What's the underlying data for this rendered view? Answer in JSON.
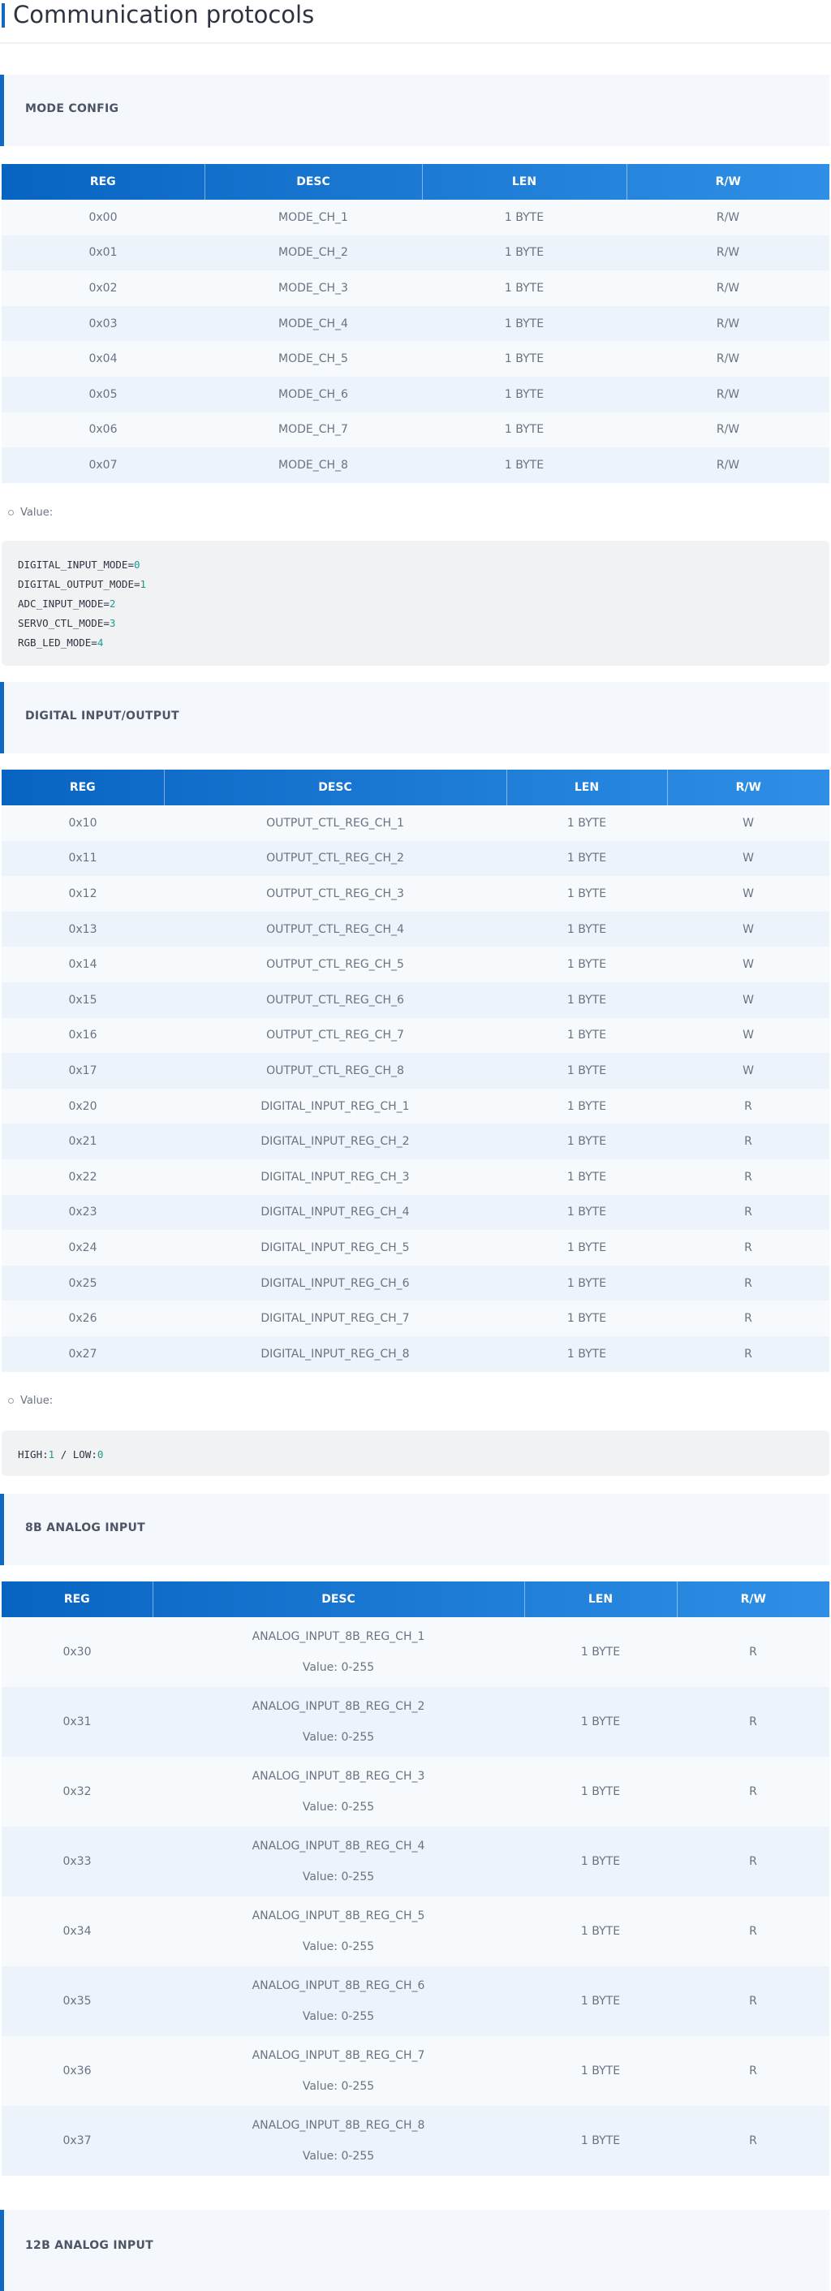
{
  "page": {
    "title": "Communication protocols"
  },
  "columns": [
    "REG",
    "DESC",
    "LEN",
    "R/W"
  ],
  "value_label": "Value:",
  "mode_config": {
    "heading": "MODE CONFIG",
    "rows": [
      [
        "0x00",
        "MODE_CH_1",
        "1 BYTE",
        "R/W"
      ],
      [
        "0x01",
        "MODE_CH_2",
        "1 BYTE",
        "R/W"
      ],
      [
        "0x02",
        "MODE_CH_3",
        "1 BYTE",
        "R/W"
      ],
      [
        "0x03",
        "MODE_CH_4",
        "1 BYTE",
        "R/W"
      ],
      [
        "0x04",
        "MODE_CH_5",
        "1 BYTE",
        "R/W"
      ],
      [
        "0x05",
        "MODE_CH_6",
        "1 BYTE",
        "R/W"
      ],
      [
        "0x06",
        "MODE_CH_7",
        "1 BYTE",
        "R/W"
      ],
      [
        "0x07",
        "MODE_CH_8",
        "1 BYTE",
        "R/W"
      ]
    ],
    "code": [
      {
        "key": "DIGITAL_INPUT_MODE=",
        "val": "0"
      },
      {
        "key": "DIGITAL_OUTPUT_MODE=",
        "val": "1"
      },
      {
        "key": "ADC_INPUT_MODE=",
        "val": "2"
      },
      {
        "key": "SERVO_CTL_MODE=",
        "val": "3"
      },
      {
        "key": "RGB_LED_MODE=",
        "val": "4"
      }
    ]
  },
  "digital_io": {
    "heading": "DIGITAL INPUT/OUTPUT",
    "rows": [
      [
        "0x10",
        "OUTPUT_CTL_REG_CH_1",
        "1 BYTE",
        "W"
      ],
      [
        "0x11",
        "OUTPUT_CTL_REG_CH_2",
        "1 BYTE",
        "W"
      ],
      [
        "0x12",
        "OUTPUT_CTL_REG_CH_3",
        "1 BYTE",
        "W"
      ],
      [
        "0x13",
        "OUTPUT_CTL_REG_CH_4",
        "1 BYTE",
        "W"
      ],
      [
        "0x14",
        "OUTPUT_CTL_REG_CH_5",
        "1 BYTE",
        "W"
      ],
      [
        "0x15",
        "OUTPUT_CTL_REG_CH_6",
        "1 BYTE",
        "W"
      ],
      [
        "0x16",
        "OUTPUT_CTL_REG_CH_7",
        "1 BYTE",
        "W"
      ],
      [
        "0x17",
        "OUTPUT_CTL_REG_CH_8",
        "1 BYTE",
        "W"
      ],
      [
        "0x20",
        "DIGITAL_INPUT_REG_CH_1",
        "1 BYTE",
        "R"
      ],
      [
        "0x21",
        "DIGITAL_INPUT_REG_CH_2",
        "1 BYTE",
        "R"
      ],
      [
        "0x22",
        "DIGITAL_INPUT_REG_CH_3",
        "1 BYTE",
        "R"
      ],
      [
        "0x23",
        "DIGITAL_INPUT_REG_CH_4",
        "1 BYTE",
        "R"
      ],
      [
        "0x24",
        "DIGITAL_INPUT_REG_CH_5",
        "1 BYTE",
        "R"
      ],
      [
        "0x25",
        "DIGITAL_INPUT_REG_CH_6",
        "1 BYTE",
        "R"
      ],
      [
        "0x26",
        "DIGITAL_INPUT_REG_CH_7",
        "1 BYTE",
        "R"
      ],
      [
        "0x27",
        "DIGITAL_INPUT_REG_CH_8",
        "1 BYTE",
        "R"
      ]
    ],
    "code": [
      {
        "parts": [
          {
            "t": "HIGH:",
            "n": false
          },
          {
            "t": "1",
            "n": true
          },
          {
            "t": " / LOW:",
            "n": false
          },
          {
            "t": "0",
            "n": true
          }
        ]
      }
    ]
  },
  "analog_8b": {
    "heading": "8B ANALOG INPUT",
    "rows": [
      [
        "0x30",
        "ANALOG_INPUT_8B_REG_CH_1",
        "Value: 0-255",
        "1 BYTE",
        "R"
      ],
      [
        "0x31",
        "ANALOG_INPUT_8B_REG_CH_2",
        "Value: 0-255",
        "1 BYTE",
        "R"
      ],
      [
        "0x32",
        "ANALOG_INPUT_8B_REG_CH_3",
        "Value: 0-255",
        "1 BYTE",
        "R"
      ],
      [
        "0x33",
        "ANALOG_INPUT_8B_REG_CH_4",
        "Value: 0-255",
        "1 BYTE",
        "R"
      ],
      [
        "0x34",
        "ANALOG_INPUT_8B_REG_CH_5",
        "Value: 0-255",
        "1 BYTE",
        "R"
      ],
      [
        "0x35",
        "ANALOG_INPUT_8B_REG_CH_6",
        "Value: 0-255",
        "1 BYTE",
        "R"
      ],
      [
        "0x36",
        "ANALOG_INPUT_8B_REG_CH_7",
        "Value: 0-255",
        "1 BYTE",
        "R"
      ],
      [
        "0x37",
        "ANALOG_INPUT_8B_REG_CH_8",
        "Value: 0-255",
        "1 BYTE",
        "R"
      ]
    ]
  },
  "analog_12b": {
    "heading": "12B ANALOG INPUT"
  },
  "colors": {
    "accent": "#1269c3",
    "header_start": "#0864c1",
    "header_end": "#2f8fe6",
    "number": "#1a9a8e"
  }
}
